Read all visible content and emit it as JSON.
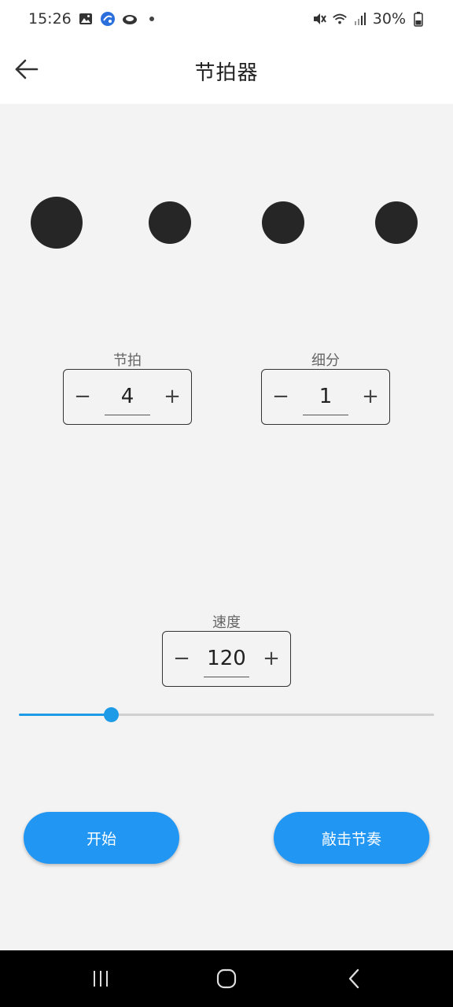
{
  "status_bar": {
    "time": "15:26",
    "battery": "30%",
    "icons": [
      "gallery-icon",
      "app-icon",
      "cloud-icon",
      "dot-icon",
      "mute-icon",
      "wifi-icon",
      "signal-icon",
      "battery-icon"
    ]
  },
  "app_bar": {
    "title": "节拍器",
    "back_icon": "arrow-left-icon"
  },
  "beat_indicators": {
    "count": 4,
    "active_index": 0,
    "color": "#262626"
  },
  "beats_field": {
    "label": "节拍",
    "value": "4",
    "minus": "−",
    "plus": "+"
  },
  "subdivision_field": {
    "label": "细分",
    "value": "1",
    "minus": "−",
    "plus": "+"
  },
  "tempo_field": {
    "label": "速度",
    "value": "120",
    "minus": "−",
    "plus": "+"
  },
  "tempo_slider": {
    "position_fraction": 0.222,
    "color": "#1e9be6"
  },
  "buttons": {
    "start": "开始",
    "tap_tempo": "敲击节奏",
    "color": "#2196f3"
  },
  "nav_bar": {
    "icons": [
      "recents-icon",
      "home-icon",
      "back-icon"
    ]
  }
}
